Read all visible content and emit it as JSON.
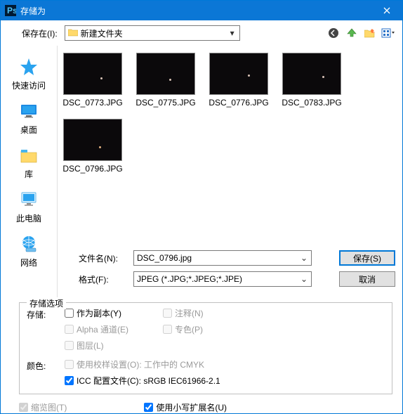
{
  "title": "存储为",
  "location": {
    "label": "保存在(I):",
    "value": "新建文件夹"
  },
  "sidebar": {
    "items": [
      {
        "label": "快速访问"
      },
      {
        "label": "桌面"
      },
      {
        "label": "库"
      },
      {
        "label": "此电脑"
      },
      {
        "label": "网络"
      }
    ]
  },
  "files": [
    {
      "name": "DSC_0773.JPG"
    },
    {
      "name": "DSC_0775.JPG"
    },
    {
      "name": "DSC_0776.JPG"
    },
    {
      "name": "DSC_0783.JPG"
    },
    {
      "name": "DSC_0796.JPG"
    }
  ],
  "filename": {
    "label": "文件名(N):",
    "value": "DSC_0796.jpg"
  },
  "format": {
    "label": "格式(F):",
    "value": "JPEG (*.JPG;*.JPEG;*.JPE)"
  },
  "buttons": {
    "save": "保存(S)",
    "cancel": "取消"
  },
  "options": {
    "legend": "存储选项",
    "save_label": "存储:",
    "as_copy": "作为副本(Y)",
    "annotation": "注释(N)",
    "alpha": "Alpha 通道(E)",
    "spot": "专色(P)",
    "layers": "图层(L)",
    "color_label": "颜色:",
    "proof": "使用校样设置(O):  工作中的 CMYK",
    "icc": "ICC 配置文件(C):  sRGB IEC61966-2.1",
    "thumbnail": "缩览图(T)",
    "lowercase": "使用小写扩展名(U)"
  }
}
